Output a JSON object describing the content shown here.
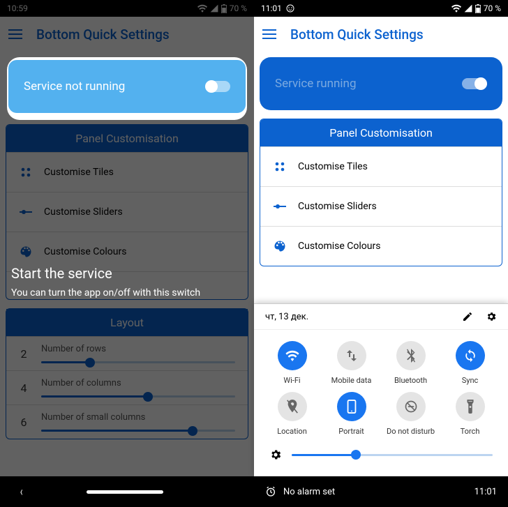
{
  "left": {
    "status": {
      "time": "10:59",
      "battery": "70 %"
    },
    "app_title": "Bottom Quick Settings",
    "service_label": "Service not running",
    "panel": {
      "title": "Panel Customisation",
      "items": [
        "Customise Tiles",
        "Customise Sliders",
        "Customise Colours"
      ]
    },
    "tutorial": {
      "heading": "Start the service",
      "body": "You can turn the app on/off with this switch"
    },
    "layout": {
      "title": "Layout",
      "rows": [
        {
          "value": "2",
          "label": "Number of rows",
          "pct": 25
        },
        {
          "value": "4",
          "label": "Number of columns",
          "pct": 55
        },
        {
          "value": "6",
          "label": "Number of small columns",
          "pct": 78
        }
      ]
    }
  },
  "right": {
    "status": {
      "time": "11:01",
      "battery": "70 %"
    },
    "app_title": "Bottom Quick Settings",
    "service_label": "Service running",
    "panel": {
      "title": "Panel Customisation",
      "items": [
        "Customise Tiles",
        "Customise Sliders",
        "Customise Colours"
      ]
    },
    "qs": {
      "date": "чт, 13 дек.",
      "tiles": [
        {
          "label": "Wi-Fi",
          "on": true
        },
        {
          "label": "Mobile data",
          "on": false
        },
        {
          "label": "Bluetooth",
          "on": false
        },
        {
          "label": "Sync",
          "on": true
        },
        {
          "label": "Location",
          "on": false
        },
        {
          "label": "Portrait",
          "on": true
        },
        {
          "label": "Do not disturb",
          "on": false
        },
        {
          "label": "Torch",
          "on": false
        }
      ],
      "brightness_pct": 32
    },
    "alarm": {
      "text": "No alarm set",
      "time": "11:01"
    }
  }
}
